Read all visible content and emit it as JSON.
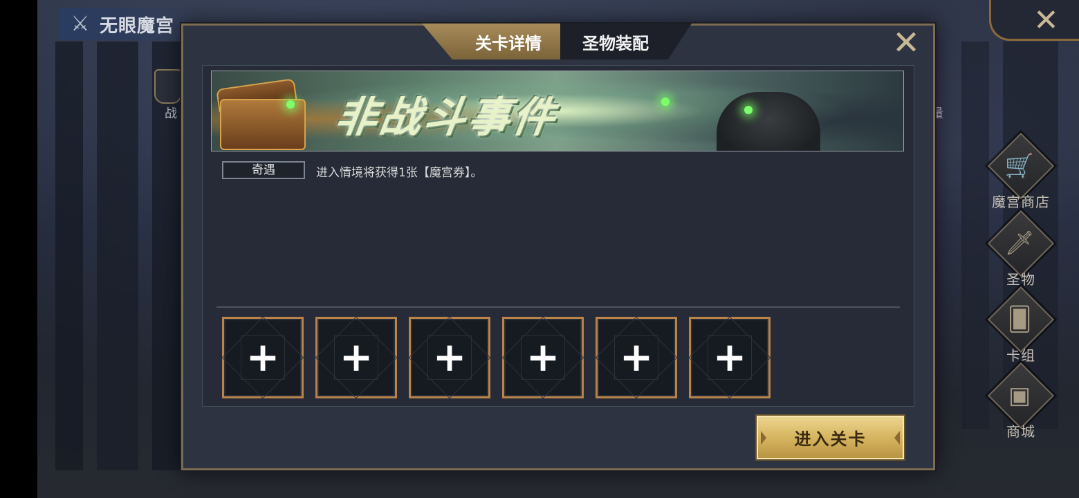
{
  "header": {
    "mode_title": "无眼魔宫",
    "left_menu_label": "战",
    "right_peek_label": "量"
  },
  "side_menu": [
    {
      "label": "魔宫商店",
      "icon": "shop-icon"
    },
    {
      "label": "圣物",
      "icon": "sword-icon"
    },
    {
      "label": "卡组",
      "icon": "cards-icon"
    },
    {
      "label": "商城",
      "icon": "chest-icon"
    }
  ],
  "modal": {
    "tabs": [
      {
        "label": "关卡详情",
        "active": true
      },
      {
        "label": "圣物装配",
        "active": false
      }
    ],
    "banner_title": "非战斗事件",
    "event_tag": "奇遇",
    "event_desc": "进入情境将获得1张【魔宫券】。",
    "slot_plus": "+",
    "slot_count": 6,
    "enter_button": "进入关卡"
  },
  "colors": {
    "accent_gold": "#d6b560",
    "slot_border": "#b9834a",
    "panel_bg": "#2d3341"
  }
}
